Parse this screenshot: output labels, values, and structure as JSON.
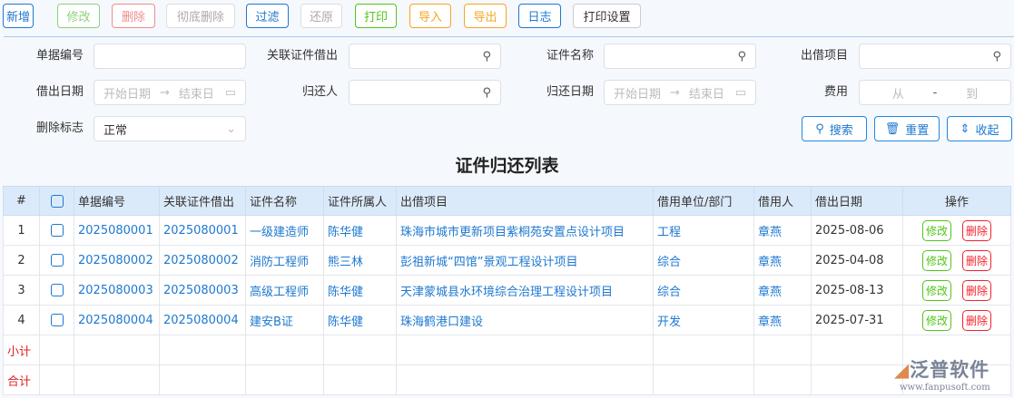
{
  "toolbar": [
    {
      "label": "新增",
      "color": "#1e78d0"
    },
    {
      "label": "修改",
      "color": "#8fd07c"
    },
    {
      "label": "删除",
      "color": "#f08c8c"
    },
    {
      "label": "彻底删除",
      "color": "#aaaaaa"
    },
    {
      "label": "过滤",
      "color": "#1e78d0"
    },
    {
      "label": "还原",
      "color": "#aaaaaa"
    },
    {
      "label": "打印",
      "color": "#52c41a"
    },
    {
      "label": "导入",
      "color": "#f5a623"
    },
    {
      "label": "导出",
      "color": "#f5a623"
    },
    {
      "label": "日志",
      "color": "#1e78d0"
    },
    {
      "label": "打印设置",
      "color": "#333333"
    }
  ],
  "filters": {
    "doc_no": {
      "label": "单据编号",
      "value": ""
    },
    "related_borrow": {
      "label": "关联证件借出",
      "value": ""
    },
    "cert_name": {
      "label": "证件名称",
      "value": ""
    },
    "project": {
      "label": "出借项目",
      "value": ""
    },
    "borrow_date": {
      "label": "借出日期",
      "start": "开始日期",
      "end": "结束日"
    },
    "returner": {
      "label": "归还人",
      "value": ""
    },
    "return_date": {
      "label": "归还日期",
      "start": "开始日期",
      "end": "结束日"
    },
    "fee": {
      "label": "费用",
      "from": "从",
      "sep": "-",
      "to": "到"
    },
    "delete_flag": {
      "label": "删除标志",
      "value": "正常"
    }
  },
  "actions": {
    "search": "搜索",
    "reset": "重置",
    "collapse": "收起"
  },
  "title": "证件归还列表",
  "table": {
    "headers": [
      "#",
      "单据编号",
      "关联证件借出",
      "证件名称",
      "证件所属人",
      "出借项目",
      "借用单位/部门",
      "借用人",
      "借出日期",
      "操作"
    ],
    "rows": [
      [
        "1",
        "2025080001",
        "2025080001",
        "一级建造师",
        "陈华健",
        "珠海市城市更新项目紫桐苑安置点设计项目",
        "工程",
        "章燕",
        "2025-08-06"
      ],
      [
        "2",
        "2025080002",
        "2025080002",
        "消防工程师",
        "熊三林",
        "彭祖新城“四馆”景观工程设计项目",
        "综合",
        "章燕",
        "2025-04-08"
      ],
      [
        "3",
        "2025080003",
        "2025080003",
        "高级工程师",
        "陈华健",
        "天津蒙城县水环境综合治理工程设计项目",
        "综合",
        "章燕",
        "2025-08-13"
      ],
      [
        "4",
        "2025080004",
        "2025080004",
        "建安B证",
        "陈华健",
        "珠海鹤港口建设",
        "开发",
        "章燕",
        "2025-07-31"
      ]
    ],
    "row_edit": "修改",
    "row_delete": "删除",
    "subtotal": "小计",
    "total": "合计"
  },
  "logo": {
    "name": "泛普软件",
    "url": "www.fanpusoft.com"
  }
}
